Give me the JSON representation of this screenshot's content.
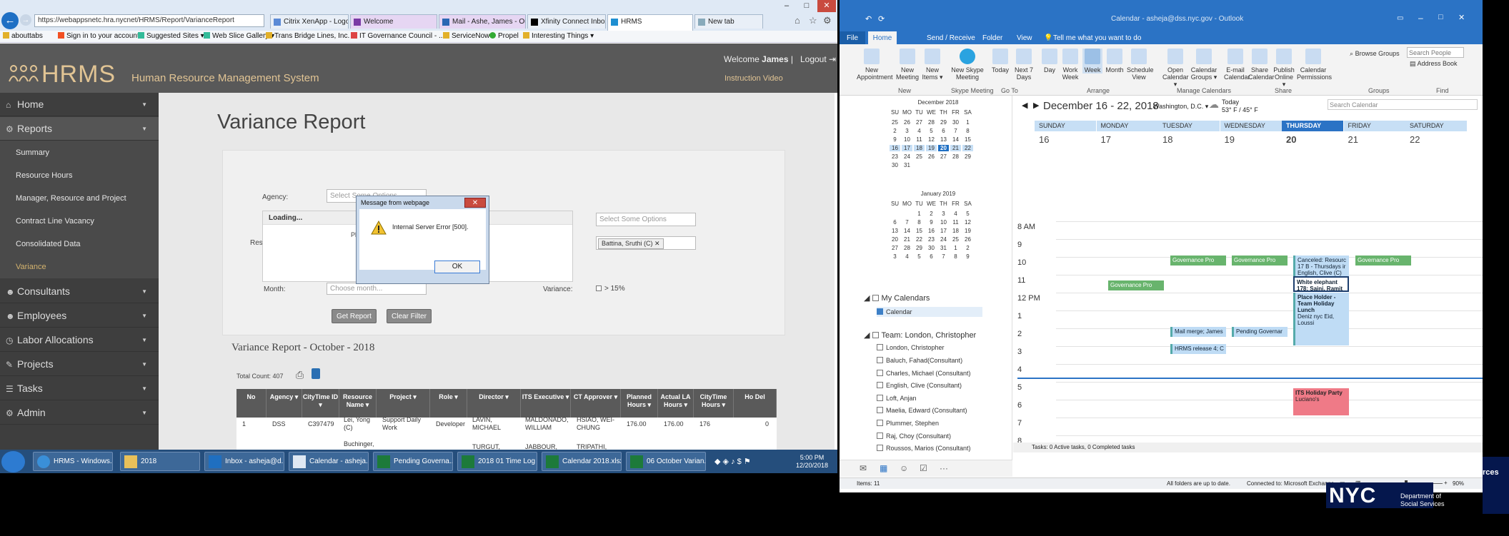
{
  "browser": {
    "url": "https://webappsnetc.hra.nycnet/HRMS/Report/VarianceReport",
    "tabs": [
      {
        "label": "Citrix XenApp - Logon"
      },
      {
        "label": "Welcome"
      },
      {
        "label": "Mail - Ashe, James - Ou..."
      },
      {
        "label": "Xfinity Connect Inbox"
      },
      {
        "label": "HRMS"
      },
      {
        "label": "New tab"
      }
    ],
    "favorites": [
      "abouttabs",
      "Sign in to your account",
      "Suggested Sites ▾",
      "Web Slice Gallery ▾",
      "Trans Bridge Lines, Inc.",
      "IT Governance Council - ...",
      "ServiceNow",
      "Propel",
      "Interesting Things ▾"
    ]
  },
  "hrms": {
    "logo": "HRMS",
    "subtitle": "Human Resource Management System",
    "welcome_prefix": "Welcome",
    "user": "James",
    "logout": "Logout",
    "instruction": "Instruction Video",
    "menu": {
      "home": "Home",
      "reports": "Reports",
      "sub": [
        "Summary",
        "Resource Hours",
        "Manager, Resource and Project",
        "Contract Line Vacancy",
        "Consolidated Data",
        "Variance"
      ],
      "consultants": "Consultants",
      "employees": "Employees",
      "labor": "Labor Allocations",
      "projects": "Projects",
      "tasks": "Tasks",
      "admin": "Admin"
    },
    "page_title": "Variance Report",
    "form": {
      "agency_label": "Agency:",
      "agency_placeholder": "Select Some Options",
      "res_label": "Res",
      "select_options": "Select Some Options",
      "chip": "Battina, Sruthi (C)",
      "month_label": "Month:",
      "month_placeholder": "Choose month...",
      "variance_label": "Variance:",
      "variance_opt": "> 15%",
      "loading": "Loading...",
      "loading_frag": "Pl",
      "get_report": "Get Report",
      "clear_filter": "Clear Filter"
    },
    "report_subtitle": "Variance Report - October - 2018",
    "total_count": "Total Count: 407",
    "table": {
      "headers": [
        "No",
        "Agency ▾",
        "CityTime ID ▾",
        "Resource Name ▾",
        "Project ▾",
        "Role ▾",
        "Director ▾",
        "ITS Executive ▾",
        "CT Approver ▾",
        "Planned Hours ▾",
        "Actual LA Hours ▾",
        "CityTime Hours ▾",
        "Ho Del"
      ],
      "rows": [
        [
          "1",
          "DSS",
          "C397479",
          "Lei, Yong (C)",
          "Support Daily Work",
          "Developer",
          "LAVIN, MICHAEL",
          "MALDONADO, WILLIAM",
          "HSIAO, WEI-CHUNG",
          "176.00",
          "176.00",
          "176",
          "0"
        ],
        [
          "",
          "",
          "",
          "Buchinger,",
          "",
          "",
          "TURGUT,",
          "JABBOUR,",
          "TRIPATHI,",
          "",
          "",
          "",
          ""
        ]
      ]
    }
  },
  "dialog": {
    "title": "Message from webpage",
    "message": "Internal Server Error [500].",
    "ok": "OK"
  },
  "taskbar": {
    "items": [
      "HRMS - Windows...",
      "2018",
      "Inbox - asheja@d...",
      "Calendar - asheja...",
      "Pending Governa...",
      "2018 01 Time Log ...",
      "Calendar 2018.xlsx...",
      "06 October Varian..."
    ],
    "time": "5:00 PM",
    "date": "12/20/2018"
  },
  "outlook": {
    "window_title": "Calendar - asheja@dss.nyc.gov - Outlook",
    "tabs": [
      "File",
      "Home",
      "Send / Receive",
      "Folder",
      "View"
    ],
    "tell_me": "Tell me what you want to do",
    "ribbon": [
      {
        "label": "New Appointment"
      },
      {
        "label": "New Meeting"
      },
      {
        "label": "New Items ▾"
      },
      {
        "label": "New Skype Meeting"
      },
      {
        "label": "Today"
      },
      {
        "label": "Next 7 Days"
      },
      {
        "label": "Day"
      },
      {
        "label": "Work Week"
      },
      {
        "label": "Week"
      },
      {
        "label": "Month"
      },
      {
        "label": "Schedule View"
      },
      {
        "label": "Open Calendar ▾"
      },
      {
        "label": "Calendar Groups ▾"
      },
      {
        "label": "E-mail Calendar"
      },
      {
        "label": "Share Calendar"
      },
      {
        "label": "Publish Online ▾"
      },
      {
        "label": "Calendar Permissions"
      }
    ],
    "groups": [
      "New",
      "Skype Meeting",
      "Go To",
      "Arrange",
      "Manage Calendars",
      "Share",
      "Groups",
      "Find"
    ],
    "browse_groups": "Browse Groups",
    "search_people": "Search People",
    "address_book": "Address Book",
    "mini1": {
      "title": "December 2018",
      "days": [
        "SU",
        "MO",
        "TU",
        "WE",
        "TH",
        "FR",
        "SA"
      ],
      "weeks": [
        [
          "25",
          "26",
          "27",
          "28",
          "29",
          "30",
          "1"
        ],
        [
          "2",
          "3",
          "4",
          "5",
          "6",
          "7",
          "8"
        ],
        [
          "9",
          "10",
          "11",
          "12",
          "13",
          "14",
          "15"
        ],
        [
          "16",
          "17",
          "18",
          "19",
          "20",
          "21",
          "22"
        ],
        [
          "23",
          "24",
          "25",
          "26",
          "27",
          "28",
          "29"
        ],
        [
          "30",
          "31",
          "",
          "",
          "",
          "",
          ""
        ]
      ]
    },
    "mini2": {
      "title": "January 2019",
      "days": [
        "SU",
        "MO",
        "TU",
        "WE",
        "TH",
        "FR",
        "SA"
      ],
      "weeks": [
        [
          "",
          "",
          "1",
          "2",
          "3",
          "4",
          "5"
        ],
        [
          "6",
          "7",
          "8",
          "9",
          "10",
          "11",
          "12"
        ],
        [
          "13",
          "14",
          "15",
          "16",
          "17",
          "18",
          "19"
        ],
        [
          "20",
          "21",
          "22",
          "23",
          "24",
          "25",
          "26"
        ],
        [
          "27",
          "28",
          "29",
          "30",
          "31",
          "1",
          "2"
        ],
        [
          "3",
          "4",
          "5",
          "6",
          "7",
          "8",
          "9"
        ]
      ]
    },
    "my_calendars": "My Calendars",
    "calendar": "Calendar",
    "team_label": "Team: London, Christopher",
    "team": [
      "London, Christopher",
      "Baluch, Fahad(Consultant)",
      "Charles, Michael (Consultant)",
      "English, Clive (Consultant)",
      "Loft, Anjan",
      "Maelia, Edward (Consultant)",
      "Plummer, Stephen",
      "Raj, Choy (Consultant)",
      "Roussos, Marios (Consultant)"
    ],
    "cal_title": "December 16 - 22, 2018",
    "location": "Washington, D.C. ▾",
    "weather_today": "Today",
    "weather": "53° F / 45° F",
    "search_cal": "Search Calendar",
    "days": [
      "SUNDAY",
      "MONDAY",
      "TUESDAY",
      "WEDNESDAY",
      "THURSDAY",
      "FRIDAY",
      "SATURDAY"
    ],
    "dates": [
      "16",
      "17",
      "18",
      "19",
      "20",
      "21",
      "22"
    ],
    "hours": [
      "8 AM",
      "9",
      "10",
      "11",
      "12 PM",
      "1",
      "2",
      "3",
      "4",
      "5",
      "6",
      "7",
      "8"
    ],
    "events": {
      "gov_tue": "Governance Pro",
      "gov_wed": "Governance Pro",
      "canceled": "Canceled: Resourc 17 B - Thursdays ir English, Clive (C)",
      "gov_fri": "Governance Pro",
      "gov_mon": "Governance Pro",
      "white_elephant": "White elephant 178; Saini, Ramit",
      "placeholder": "Place Holder - Team Holiday Lunch",
      "placeholder2": "Deniz nyc Eid, Loussi",
      "mail_merge": "Mail merge; James",
      "pending": "Pending Governar",
      "hrms_release": "HRMS release 4; C",
      "party": "ITS Holiday Party",
      "party_loc": "Luciano's"
    },
    "tasks_line": "Tasks: 0 Active tasks, 0 Completed tasks",
    "items": "Items: 11",
    "status1": "All folders are up to date.",
    "status2": "Connected to: Microsoft Exchange",
    "zoom": "90%"
  },
  "wallpaper": {
    "frag1": "rces",
    "frag2": "Department of",
    "frag3": "Social Services",
    "logo": "NYC"
  },
  "colors": {
    "hrms_gold": "#e1c494",
    "outlook_blue": "#2b73c5",
    "event_green": "#68b46d",
    "event_red": "#ef7a87",
    "today_blue": "#1e6fc4"
  }
}
